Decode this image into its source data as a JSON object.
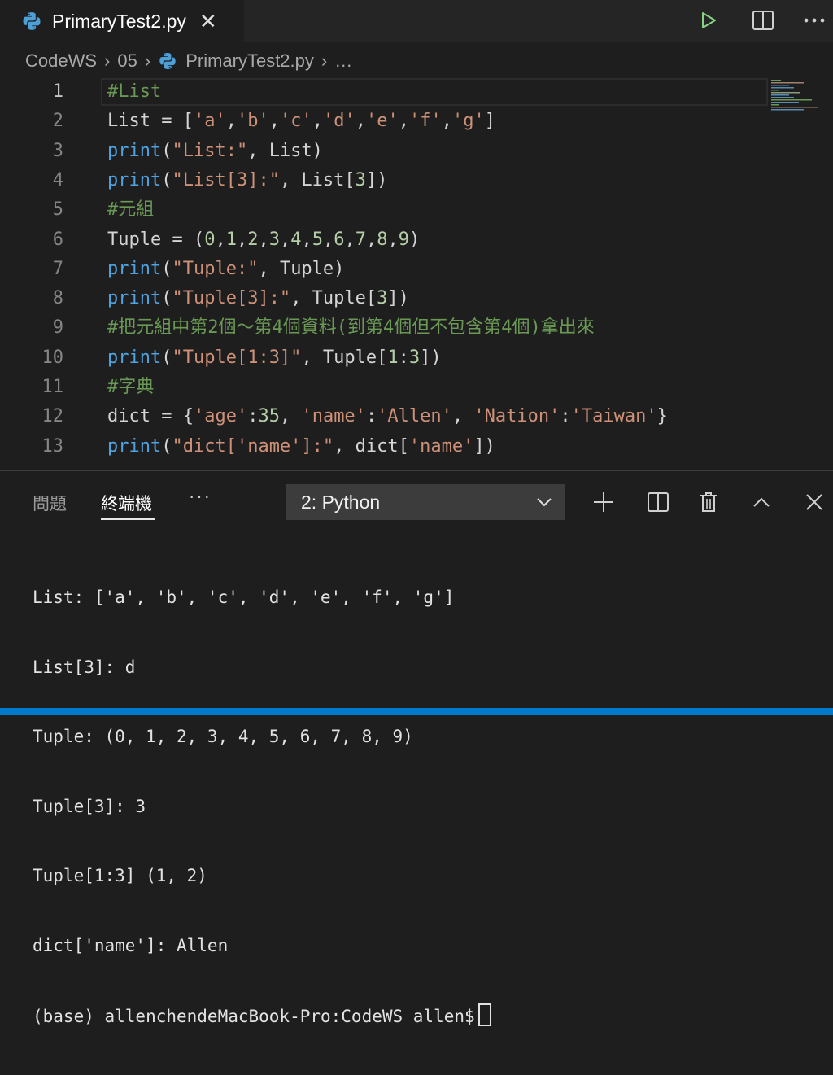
{
  "tab": {
    "title": "PrimaryTest2.py",
    "close": "✕"
  },
  "breadcrumb": {
    "items": [
      "CodeWS",
      "05",
      "PrimaryTest2.py",
      "…"
    ]
  },
  "editor": {
    "lines": [
      {
        "n": "1",
        "tokens": [
          [
            "cm",
            "#List"
          ]
        ]
      },
      {
        "n": "2",
        "tokens": [
          [
            "",
            "List = ["
          ],
          [
            "st",
            "'a'"
          ],
          [
            "",
            ","
          ],
          [
            "st",
            "'b'"
          ],
          [
            "",
            ","
          ],
          [
            "st",
            "'c'"
          ],
          [
            "",
            ","
          ],
          [
            "st",
            "'d'"
          ],
          [
            "",
            ","
          ],
          [
            "st",
            "'e'"
          ],
          [
            "",
            ","
          ],
          [
            "st",
            "'f'"
          ],
          [
            "",
            ","
          ],
          [
            "st",
            "'g'"
          ],
          [
            "",
            "]"
          ]
        ]
      },
      {
        "n": "3",
        "tokens": [
          [
            "fn",
            "print"
          ],
          [
            "",
            "("
          ],
          [
            "st",
            "\"List:\""
          ],
          [
            "",
            ", List)"
          ]
        ]
      },
      {
        "n": "4",
        "tokens": [
          [
            "fn",
            "print"
          ],
          [
            "",
            "("
          ],
          [
            "st",
            "\"List[3]:\""
          ],
          [
            "",
            ", List["
          ],
          [
            "nm",
            "3"
          ],
          [
            "",
            "])"
          ]
        ]
      },
      {
        "n": "5",
        "tokens": [
          [
            "cm",
            "#元組"
          ]
        ]
      },
      {
        "n": "6",
        "tokens": [
          [
            "",
            "Tuple = ("
          ],
          [
            "nm",
            "0"
          ],
          [
            "",
            ","
          ],
          [
            "nm",
            "1"
          ],
          [
            "",
            ","
          ],
          [
            "nm",
            "2"
          ],
          [
            "",
            ","
          ],
          [
            "nm",
            "3"
          ],
          [
            "",
            ","
          ],
          [
            "nm",
            "4"
          ],
          [
            "",
            ","
          ],
          [
            "nm",
            "5"
          ],
          [
            "",
            ","
          ],
          [
            "nm",
            "6"
          ],
          [
            "",
            ","
          ],
          [
            "nm",
            "7"
          ],
          [
            "",
            ","
          ],
          [
            "nm",
            "8"
          ],
          [
            "",
            ","
          ],
          [
            "nm",
            "9"
          ],
          [
            "",
            ")"
          ]
        ]
      },
      {
        "n": "7",
        "tokens": [
          [
            "fn",
            "print"
          ],
          [
            "",
            "("
          ],
          [
            "st",
            "\"Tuple:\""
          ],
          [
            "",
            ", Tuple)"
          ]
        ]
      },
      {
        "n": "8",
        "tokens": [
          [
            "fn",
            "print"
          ],
          [
            "",
            "("
          ],
          [
            "st",
            "\"Tuple[3]:\""
          ],
          [
            "",
            ", Tuple["
          ],
          [
            "nm",
            "3"
          ],
          [
            "",
            "])"
          ]
        ]
      },
      {
        "n": "9",
        "tokens": [
          [
            "cm",
            "#把元組中第2個～第4個資料(到第4個但不包含第4個)拿出來"
          ]
        ]
      },
      {
        "n": "10",
        "tokens": [
          [
            "fn",
            "print"
          ],
          [
            "",
            "("
          ],
          [
            "st",
            "\"Tuple[1:3]\""
          ],
          [
            "",
            ", Tuple["
          ],
          [
            "nm",
            "1"
          ],
          [
            "",
            ":"
          ],
          [
            "nm",
            "3"
          ],
          [
            "",
            "])"
          ]
        ]
      },
      {
        "n": "11",
        "tokens": [
          [
            "cm",
            "#字典"
          ]
        ]
      },
      {
        "n": "12",
        "tokens": [
          [
            "",
            "dict = {"
          ],
          [
            "st",
            "'age'"
          ],
          [
            "",
            ":"
          ],
          [
            "nm",
            "35"
          ],
          [
            "",
            ", "
          ],
          [
            "st",
            "'name'"
          ],
          [
            "",
            ":"
          ],
          [
            "st",
            "'Allen'"
          ],
          [
            "",
            ", "
          ],
          [
            "st",
            "'Nation'"
          ],
          [
            "",
            ":"
          ],
          [
            "st",
            "'Taiwan'"
          ],
          [
            "",
            "}"
          ]
        ]
      },
      {
        "n": "13",
        "tokens": [
          [
            "fn",
            "print"
          ],
          [
            "",
            "("
          ],
          [
            "st",
            "\"dict['name']:\""
          ],
          [
            "",
            ", dict["
          ],
          [
            "st",
            "'name'"
          ],
          [
            "",
            "])"
          ]
        ]
      }
    ]
  },
  "panel": {
    "tabs": [
      "問題",
      "終端機"
    ],
    "more": "···",
    "terminal_select": "2: Python",
    "terminal_lines": [
      "List: ['a', 'b', 'c', 'd', 'e', 'f', 'g']",
      "List[3]: d",
      "Tuple: (0, 1, 2, 3, 4, 5, 6, 7, 8, 9)",
      "Tuple[3]: 3",
      "Tuple[1:3] (1, 2)",
      "dict['name']: Allen"
    ],
    "prompt": "(base) allenchendeMacBook-Pro:CodeWS allen$"
  },
  "colors": {
    "accent": "#007acc",
    "comment": "#6a9955",
    "function": "#4fa3e0",
    "string": "#ce9178",
    "number": "#b5cea8",
    "run": "#89d185"
  },
  "icons": [
    "python-file-icon",
    "close-icon",
    "run-icon",
    "split-editor-icon",
    "more-icon",
    "chevron-right-icon",
    "chevron-down-icon",
    "plus-icon",
    "split-terminal-icon",
    "trash-icon",
    "chevron-up-icon",
    "close-panel-icon"
  ]
}
